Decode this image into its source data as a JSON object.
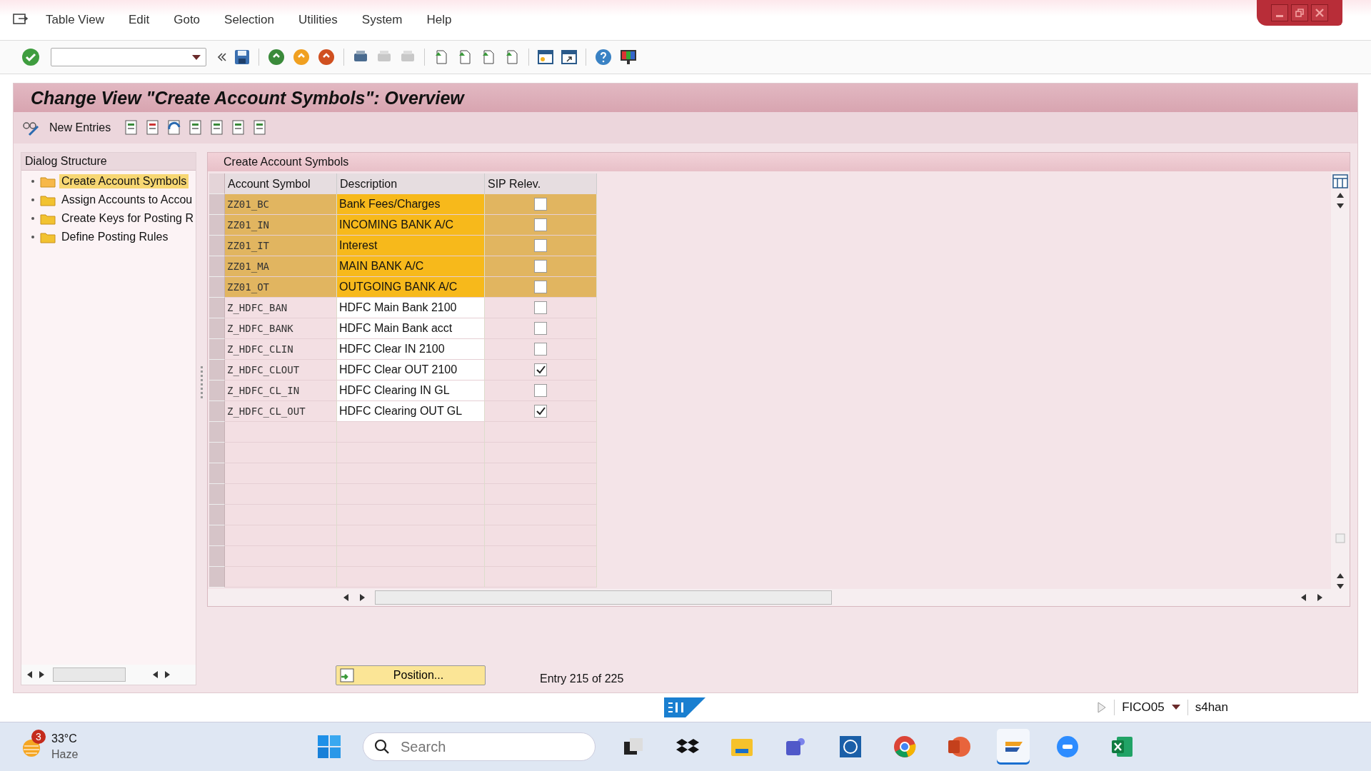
{
  "menu": [
    "Table View",
    "Edit",
    "Goto",
    "Selection",
    "Utilities",
    "System",
    "Help"
  ],
  "title": "Change View \"Create Account Symbols\": Overview",
  "app_toolbar": {
    "new_entries": "New Entries"
  },
  "dialog_structure": {
    "title": "Dialog Structure",
    "items": [
      {
        "label": "Create Account Symbols",
        "selected": true
      },
      {
        "label": "Assign Accounts to Accou",
        "selected": false
      },
      {
        "label": "Create Keys for Posting R",
        "selected": false
      },
      {
        "label": "Define Posting Rules",
        "selected": false
      }
    ]
  },
  "table": {
    "title": "Create Account Symbols",
    "columns": [
      "Account Symbol",
      "Description",
      "SIP Relev."
    ],
    "rows": [
      {
        "account_symbol": "ZZ01_BC",
        "description": "Bank Fees/Charges",
        "sip_relev": false,
        "selected": true
      },
      {
        "account_symbol": "ZZ01_IN",
        "description": "INCOMING BANK A/C",
        "sip_relev": false,
        "selected": true
      },
      {
        "account_symbol": "ZZ01_IT",
        "description": "Interest",
        "sip_relev": false,
        "selected": true
      },
      {
        "account_symbol": "ZZ01_MA",
        "description": "MAIN BANK A/C",
        "sip_relev": false,
        "selected": true
      },
      {
        "account_symbol": "ZZ01_OT",
        "description": "OUTGOING BANK A/C",
        "sip_relev": false,
        "selected": true
      },
      {
        "account_symbol": "Z_HDFC_BAN",
        "description": "HDFC Main Bank 2100",
        "sip_relev": false,
        "selected": false
      },
      {
        "account_symbol": "Z_HDFC_BANK",
        "description": "HDFC Main Bank acct",
        "sip_relev": false,
        "selected": false
      },
      {
        "account_symbol": "Z_HDFC_CLIN",
        "description": "HDFC Clear IN 2100",
        "sip_relev": false,
        "selected": false
      },
      {
        "account_symbol": "Z_HDFC_CLOUT",
        "description": "HDFC Clear OUT 2100",
        "sip_relev": true,
        "selected": false
      },
      {
        "account_symbol": "Z_HDFC_CL_IN",
        "description": "HDFC Clearing IN GL",
        "sip_relev": false,
        "selected": false
      },
      {
        "account_symbol": "Z_HDFC_CL_OUT",
        "description": "HDFC Clearing OUT GL",
        "sip_relev": true,
        "selected": false
      }
    ]
  },
  "position_button": "Position...",
  "entry_info": "Entry 215 of 225",
  "status_bar": {
    "transaction": "FICO05",
    "system": "s4han"
  },
  "taskbar": {
    "weather": {
      "badge": "3",
      "temperature": "33°C",
      "condition": "Haze"
    },
    "search": {
      "placeholder": "Search"
    },
    "apps": [
      {
        "kind": "taskview",
        "selected": false
      },
      {
        "kind": "dropbox",
        "selected": false
      },
      {
        "kind": "files",
        "selected": false
      },
      {
        "kind": "teams",
        "selected": false
      },
      {
        "kind": "globe",
        "selected": false
      },
      {
        "kind": "chrome",
        "selected": false
      },
      {
        "kind": "powerpoint",
        "selected": false
      },
      {
        "kind": "sap",
        "selected": true
      },
      {
        "kind": "zoom",
        "selected": false
      },
      {
        "kind": "excel",
        "selected": false
      }
    ]
  }
}
